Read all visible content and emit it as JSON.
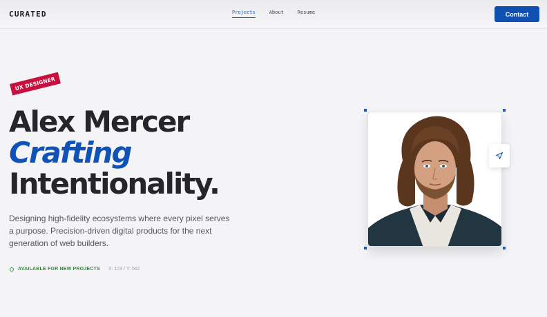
{
  "header": {
    "brand": "CURATED",
    "nav": [
      {
        "label": "Projects",
        "active": true
      },
      {
        "label": "About",
        "active": false
      },
      {
        "label": "Resume",
        "active": false
      }
    ],
    "contact_label": "Contact"
  },
  "hero": {
    "badge": "UX DESIGNER",
    "name": "Alex Mercer",
    "accent": "Crafting",
    "tagline": "Intentionality.",
    "description": "Designing high-fidelity ecosystems where every pixel serves a purpose. Precision-driven digital products for the next generation of web builders.",
    "status": "AVAILABLE FOR NEW PROJECTS",
    "coords": "X: 124 / Y: 562"
  },
  "portrait": {
    "icon": "send-icon"
  },
  "colors": {
    "accent": "#0f52b8",
    "badge": "#c8103f",
    "status": "#2e8b3a"
  }
}
